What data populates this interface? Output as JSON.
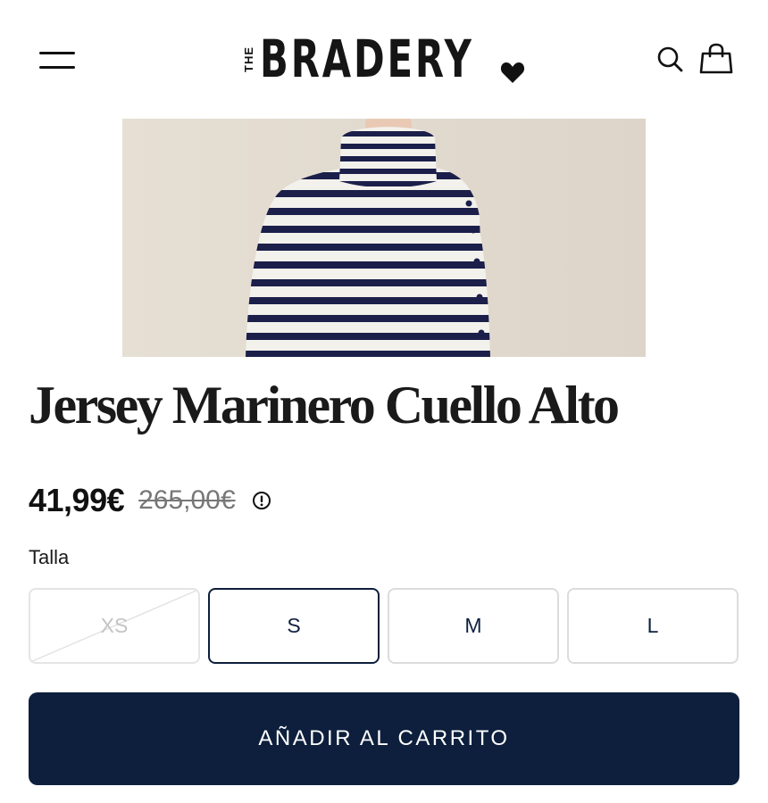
{
  "header": {
    "logo_prefix": "THE",
    "logo_text": "BRADERY",
    "icons": {
      "menu": "hamburger-menu-icon",
      "search": "search-icon",
      "cart": "shopping-bag-icon",
      "logo_mark": "heart-icon"
    }
  },
  "product": {
    "image": "striped-turtleneck-sweater-photo",
    "title": "Jersey Marinero Cuello Alto",
    "price": "41,99€",
    "original_price": "265,00€",
    "info_icon": "info-circle-icon"
  },
  "size": {
    "label": "Talla",
    "options": [
      {
        "label": "XS",
        "state": "unavailable"
      },
      {
        "label": "S",
        "state": "selected"
      },
      {
        "label": "M",
        "state": "available"
      },
      {
        "label": "L",
        "state": "available"
      }
    ]
  },
  "cta": {
    "add_to_cart": "AÑADIR AL CARRITO"
  },
  "colors": {
    "brand_navy": "#0d1f3c",
    "text": "#111111",
    "muted": "#777777",
    "border": "#dcdcdc",
    "disabled": "#c4c4c4"
  }
}
